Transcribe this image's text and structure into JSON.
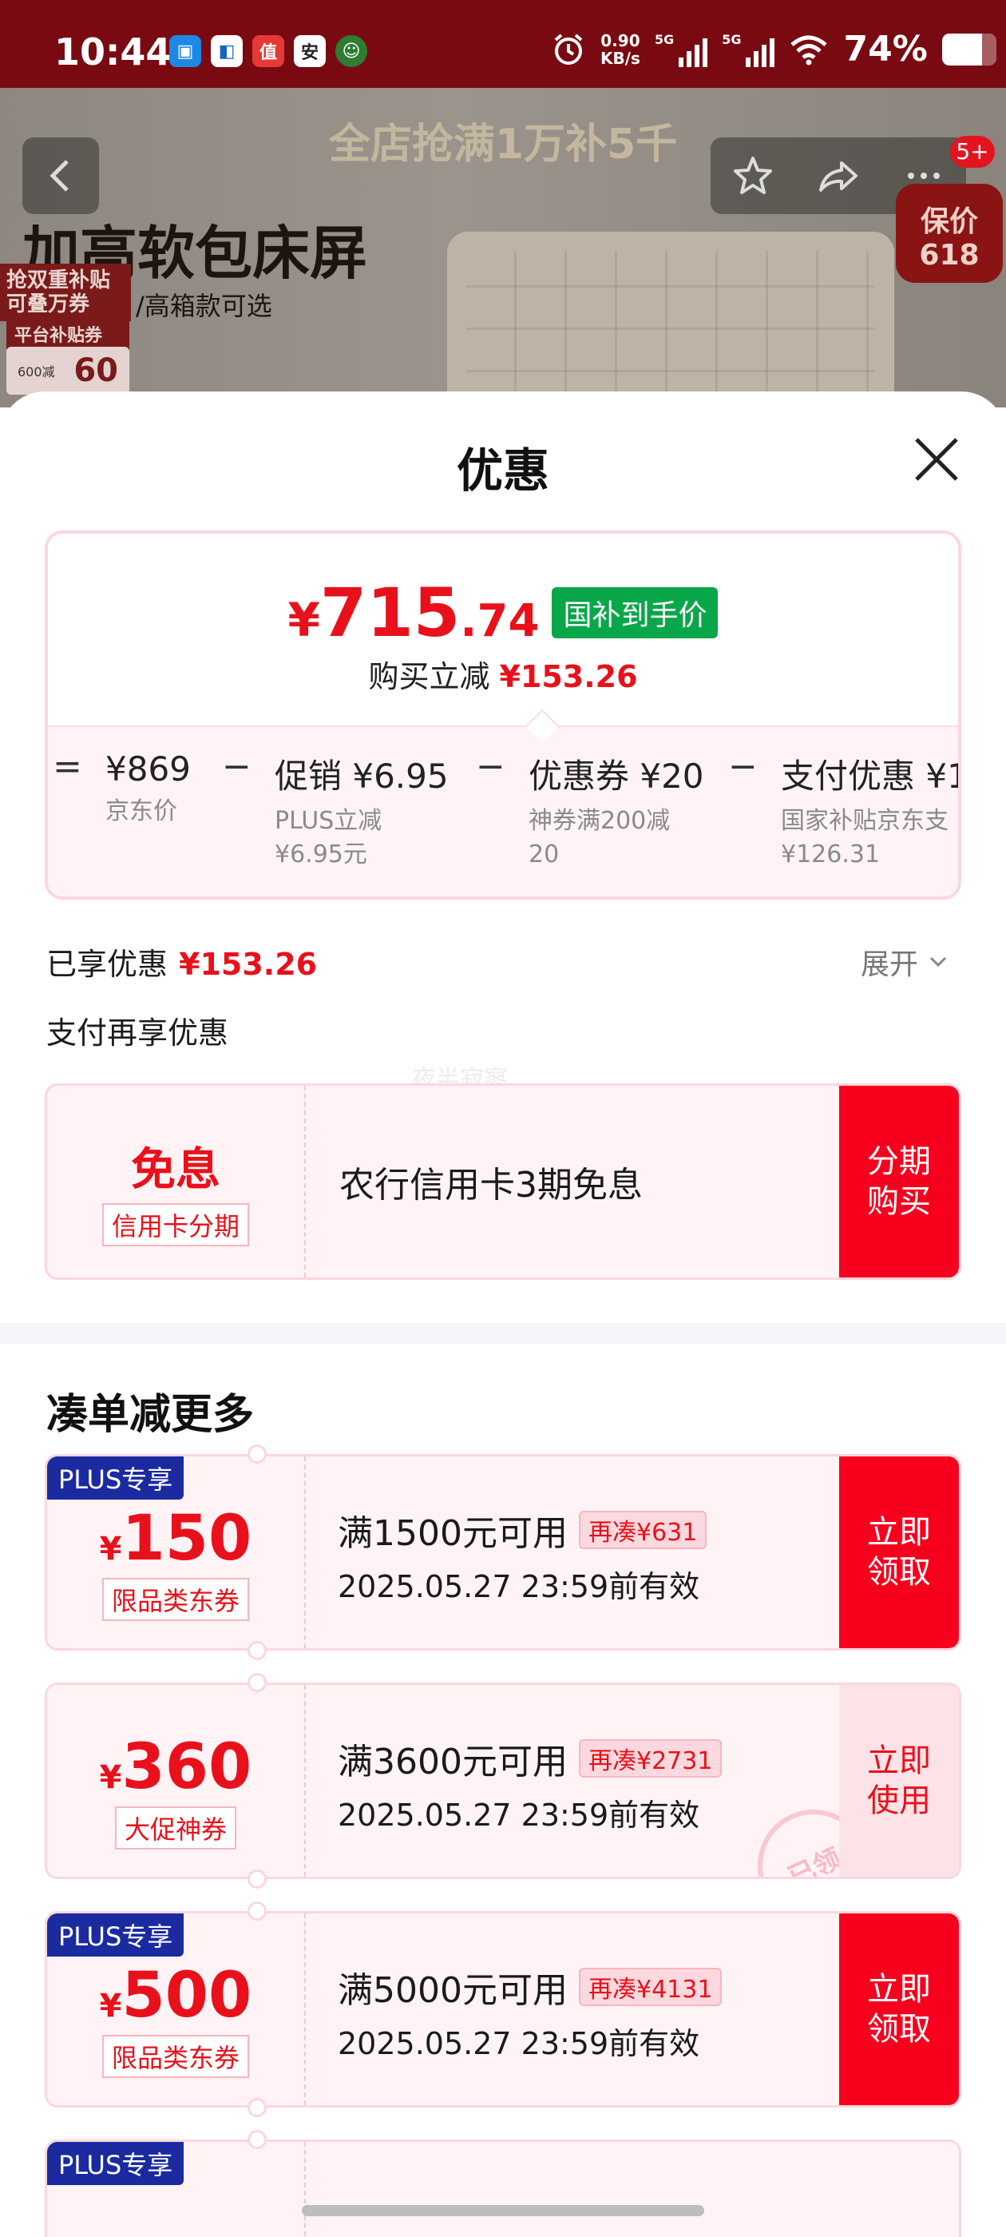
{
  "status_bar": {
    "time": "10:44",
    "net_speed_value": "0.90",
    "net_speed_unit": "KB/s",
    "net1": "5G",
    "net2": "5G",
    "battery": "74%",
    "battery_level": 0.74
  },
  "banner": {
    "promo": "全店抢满1万补5千",
    "title": "加高软包床屏",
    "tag1": "抢双重补贴可叠万券",
    "subtitle": "/高箱款可选",
    "tag2": "平台补贴券",
    "coupon_small": "600减",
    "coupon_big": "60",
    "cart_badge": "5+",
    "seal_line1": "保价",
    "seal_line2": "618"
  },
  "sheet": {
    "title": "优惠"
  },
  "price_card": {
    "currency": "¥",
    "price_int": "715",
    "price_dec": ".74",
    "price_badge": "国补到手价",
    "reduce_label": "购买立减",
    "reduce_value": "¥153.26",
    "breakdown": [
      {
        "op": "=",
        "main": "¥869",
        "sub1": "京东价",
        "sub2": ""
      },
      {
        "op": "−",
        "main": "促销 ¥6.95",
        "sub1": "PLUS立减",
        "sub2": "¥6.95元"
      },
      {
        "op": "−",
        "main": "优惠券 ¥20",
        "sub1": "神券满200减",
        "sub2": "20"
      },
      {
        "op": "−",
        "main": "支付优惠 ¥1",
        "sub1": "国家补贴京东支",
        "sub2": "¥126.31"
      }
    ]
  },
  "enjoyed": {
    "label": "已享优惠",
    "value": "¥153.26",
    "expand": "展开"
  },
  "pay_more": {
    "label": "支付再享优惠",
    "watermark": "夜半寂寥"
  },
  "installment": {
    "big": "免息",
    "tag": "信用卡分期",
    "text": "农行信用卡3期免息",
    "button": "分期\n购买"
  },
  "more_section": {
    "title": "凑单减更多"
  },
  "coupons": [
    {
      "plus": "PLUS专享",
      "currency": "¥",
      "amount": "150",
      "tag": "限品类东券",
      "condition": "满1500元可用",
      "more": "再凑¥631",
      "valid": "2025.05.27 23:59前有效",
      "button": "立即\n领取",
      "used": false
    },
    {
      "plus": "",
      "currency": "¥",
      "amount": "360",
      "tag": "大促神券",
      "condition": "满3600元可用",
      "more": "再凑¥2731",
      "valid": "2025.05.27 23:59前有效",
      "button": "立即\n使用",
      "used": true,
      "stamp": "已领"
    },
    {
      "plus": "PLUS专享",
      "currency": "¥",
      "amount": "500",
      "tag": "限品类东券",
      "condition": "满5000元可用",
      "more": "再凑¥4131",
      "valid": "2025.05.27 23:59前有效",
      "button": "立即\n领取",
      "used": false
    },
    {
      "plus": "PLUS专享"
    }
  ],
  "colors": {
    "accent_red": "#e8111b",
    "button_red": "#f7001e",
    "guobu_green": "#0aa74a",
    "plus_blue": "#1b2a9f"
  }
}
